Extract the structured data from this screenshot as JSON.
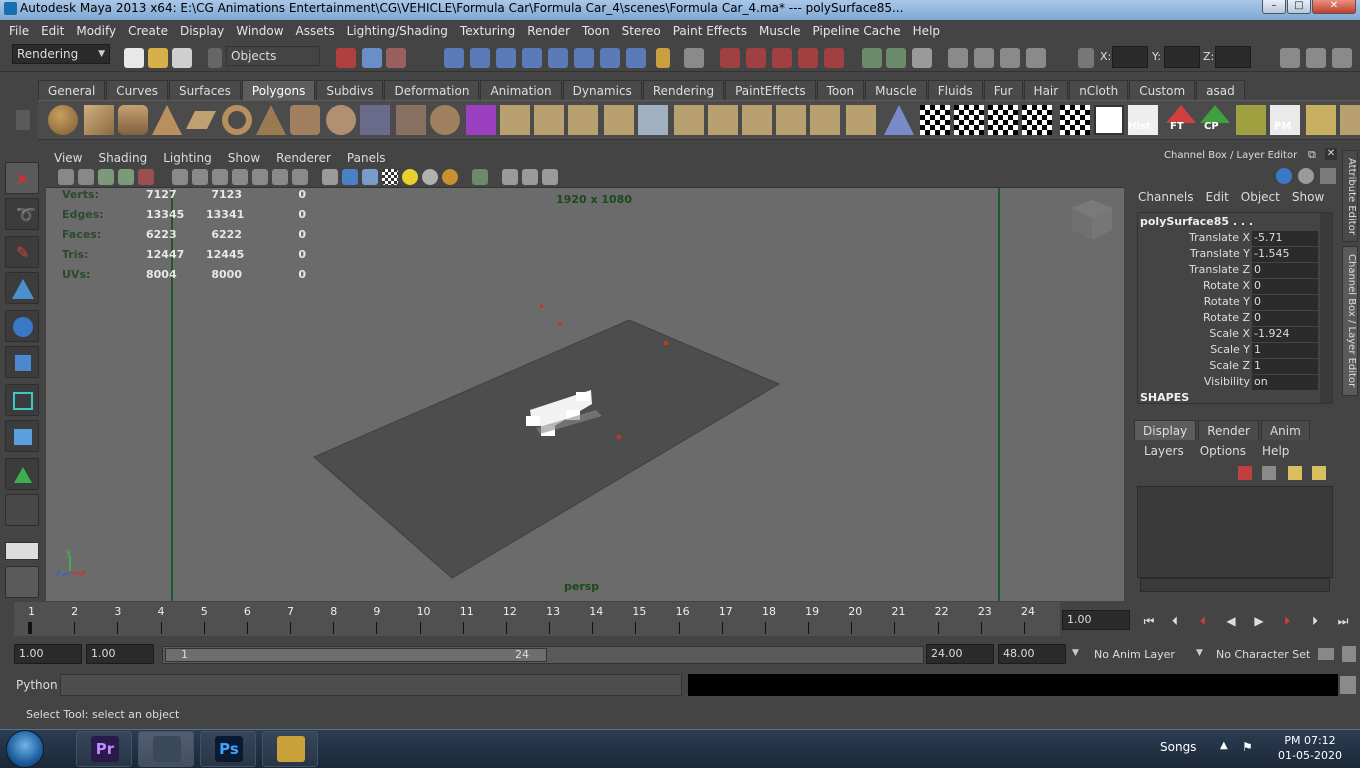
{
  "window": {
    "title": "Autodesk Maya 2013 x64: E:\\CG Animations Entertainment\\CG\\VEHICLE\\Formula Car\\Formula Car_4\\scenes\\Formula Car_4.ma*   ---   polySurface85..."
  },
  "menubar": [
    "File",
    "Edit",
    "Modify",
    "Create",
    "Display",
    "Window",
    "Assets",
    "Lighting/Shading",
    "Texturing",
    "Render",
    "Toon",
    "Stereo",
    "Paint Effects",
    "Muscle",
    "Pipeline Cache",
    "Help"
  ],
  "statusline": {
    "menuset": "Rendering",
    "selection_mode": "Objects",
    "x_label": "X:",
    "y_label": "Y:",
    "z_label": "Z:"
  },
  "shelf": {
    "tabs": [
      "General",
      "Curves",
      "Surfaces",
      "Polygons",
      "Subdivs",
      "Deformation",
      "Animation",
      "Dynamics",
      "Rendering",
      "PaintEffects",
      "Toon",
      "Muscle",
      "Fluids",
      "Fur",
      "Hair",
      "nCloth",
      "Custom",
      "asad"
    ],
    "active_tab": "Polygons",
    "labels": {
      "hist": "Hist",
      "ft": "FT",
      "cp": "CP",
      "pm": "PM"
    }
  },
  "viewport": {
    "menu": [
      "View",
      "Shading",
      "Lighting",
      "Show",
      "Renderer",
      "Panels"
    ],
    "resolution": "1920 x 1080",
    "camera": "persp",
    "hud": [
      {
        "label": "Verts:",
        "a": "7127",
        "b": "7123",
        "c": "0"
      },
      {
        "label": "Edges:",
        "a": "13345",
        "b": "13341",
        "c": "0"
      },
      {
        "label": "Faces:",
        "a": "6223",
        "b": "6222",
        "c": "0"
      },
      {
        "label": "Tris:",
        "a": "12447",
        "b": "12445",
        "c": "0"
      },
      {
        "label": "UVs:",
        "a": "8004",
        "b": "8000",
        "c": "0"
      }
    ],
    "axis": {
      "y": "y",
      "z": "z",
      "x": "x"
    }
  },
  "channelbox": {
    "header": "Channel Box / Layer Editor",
    "menu": [
      "Channels",
      "Edit",
      "Object",
      "Show"
    ],
    "object": "polySurface85 . . .",
    "channels": [
      {
        "name": "Translate X",
        "value": "-5.71"
      },
      {
        "name": "Translate Y",
        "value": "-1.545"
      },
      {
        "name": "Translate Z",
        "value": "0"
      },
      {
        "name": "Rotate X",
        "value": "0"
      },
      {
        "name": "Rotate Y",
        "value": "0"
      },
      {
        "name": "Rotate Z",
        "value": "0"
      },
      {
        "name": "Scale X",
        "value": "-1.924"
      },
      {
        "name": "Scale Y",
        "value": "1"
      },
      {
        "name": "Scale Z",
        "value": "1"
      },
      {
        "name": "Visibility",
        "value": "on"
      }
    ],
    "shapes": "SHAPES"
  },
  "layereditor": {
    "tabs": [
      "Display",
      "Render",
      "Anim"
    ],
    "active_tab": "Display",
    "menu": [
      "Layers",
      "Options",
      "Help"
    ]
  },
  "sidetabs": {
    "attribute_editor": "Attribute Editor",
    "channel_box": "Channel Box / Layer Editor"
  },
  "timeline": {
    "ticks": [
      "1",
      "2",
      "3",
      "4",
      "5",
      "6",
      "7",
      "8",
      "9",
      "10",
      "11",
      "12",
      "13",
      "14",
      "15",
      "16",
      "17",
      "18",
      "19",
      "20",
      "21",
      "22",
      "23",
      "24"
    ],
    "current_frame": "1.00",
    "range_start_outer": "1.00",
    "range_start_inner": "1.00",
    "range_slider_start": "1",
    "range_slider_end": "24",
    "range_end_inner": "24.00",
    "range_end_outer": "48.00",
    "anim_layer": "No Anim Layer",
    "character_set": "No Character Set"
  },
  "commandline": {
    "language": "Python",
    "help": "Select Tool: select an object"
  },
  "taskbar": {
    "apps": [
      {
        "name": "premiere",
        "label": "Pr",
        "color": "#2a1a4a",
        "fg": "#c08aff"
      },
      {
        "name": "maya",
        "label": "",
        "color": "#3a4a5c",
        "fg": "#ddd"
      },
      {
        "name": "photoshop",
        "label": "Ps",
        "color": "#0b1a33",
        "fg": "#3da5ff"
      },
      {
        "name": "explorer",
        "label": "",
        "color": "#c9a23a",
        "fg": "#fff"
      }
    ],
    "tray_label": "Songs",
    "time": "PM 07:12",
    "date": "01-05-2020"
  }
}
